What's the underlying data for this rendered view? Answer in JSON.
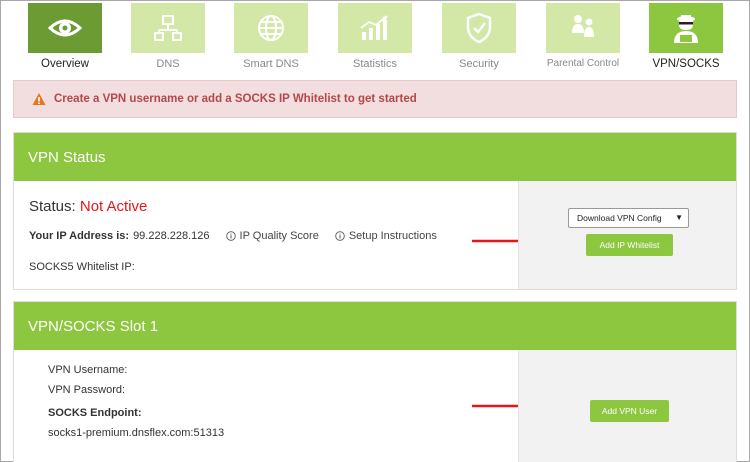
{
  "nav": {
    "items": [
      {
        "label": "Overview",
        "icon": "eye-icon"
      },
      {
        "label": "DNS",
        "icon": "network-icon"
      },
      {
        "label": "Smart DNS",
        "icon": "globe-icon"
      },
      {
        "label": "Statistics",
        "icon": "chart-icon"
      },
      {
        "label": "Security",
        "icon": "shield-icon"
      },
      {
        "label": "Parental Control",
        "icon": "family-icon"
      },
      {
        "label": "VPN/SOCKS",
        "icon": "hacker-icon"
      }
    ],
    "active": "Overview"
  },
  "alert": {
    "text": "Create a VPN username or add a SOCKS IP Whitelist to get started",
    "icon": "warning-icon"
  },
  "vpn_status": {
    "title": "VPN Status",
    "status_label": "Status:",
    "status_value": "Not Active",
    "ip_label": "Your IP Address is:",
    "ip_value": "99.228.228.126",
    "ip_quality": "IP Quality Score",
    "setup": "Setup Instructions",
    "socks_whitelist": "SOCKS5 Whitelist IP:",
    "download_select": "Download VPN Config",
    "add_whitelist": "Add IP Whitelist"
  },
  "slot": {
    "title": "VPN/SOCKS Slot 1",
    "username_label": "VPN Username:",
    "password_label": "VPN Password:",
    "endpoint_label": "SOCKS Endpoint:",
    "endpoint_value": "socks1-premium.dnsflex.com:51313",
    "add_user": "Add VPN User"
  },
  "colors": {
    "green": "#8dc63f",
    "green_dark": "#6c9a33",
    "green_light": "#d3e7a6",
    "alert_bg": "#f2dede",
    "alert_text": "#b44848",
    "status_red": "#e8151a",
    "arrow_red": "#e8151a"
  }
}
